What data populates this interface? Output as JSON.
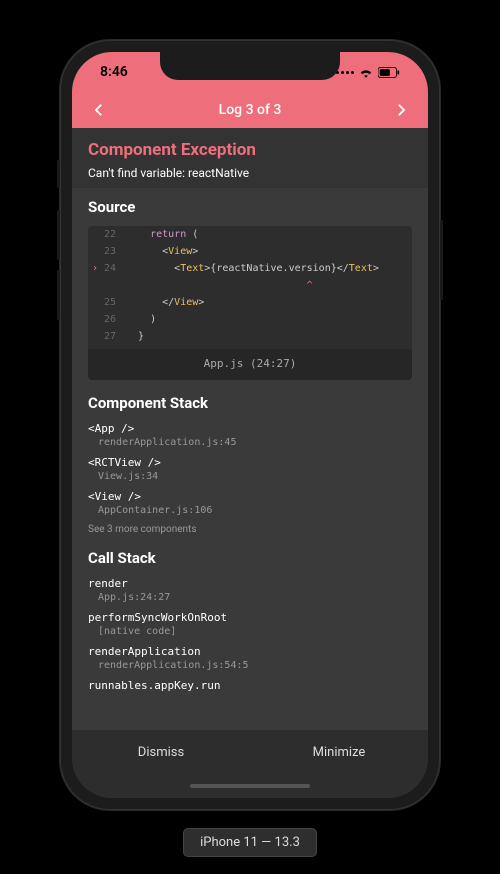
{
  "status": {
    "time": "8:46"
  },
  "nav": {
    "title": "Log 3 of 3"
  },
  "error": {
    "title": "Component Exception",
    "message": "Can't find variable: reactNative"
  },
  "source": {
    "heading": "Source",
    "lines": [
      {
        "num": "22",
        "indent": "    ",
        "tokens": [
          {
            "t": "kw",
            "v": "return"
          },
          {
            "t": "",
            "v": " ("
          }
        ]
      },
      {
        "num": "23",
        "indent": "      ",
        "tokens": [
          {
            "t": "",
            "v": "<"
          },
          {
            "t": "tag",
            "v": "View"
          },
          {
            "t": "",
            "v": ">"
          }
        ]
      },
      {
        "num": "24",
        "hl": true,
        "indent": "        ",
        "tokens": [
          {
            "t": "",
            "v": "<"
          },
          {
            "t": "tag",
            "v": "Text"
          },
          {
            "t": "",
            "v": ">{reactNative.version}</"
          },
          {
            "t": "tag",
            "v": "Text"
          },
          {
            "t": "",
            "v": ">"
          }
        ]
      },
      {
        "caret": true,
        "indent": "                              ",
        "mark": "^"
      },
      {
        "num": "25",
        "indent": "      ",
        "tokens": [
          {
            "t": "",
            "v": "</"
          },
          {
            "t": "tag",
            "v": "View"
          },
          {
            "t": "",
            "v": ">"
          }
        ]
      },
      {
        "num": "26",
        "indent": "    ",
        "tokens": [
          {
            "t": "",
            "v": ")"
          }
        ]
      },
      {
        "num": "27",
        "indent": "  ",
        "tokens": [
          {
            "t": "",
            "v": "}"
          }
        ]
      }
    ],
    "footer": "App.js (24:27)"
  },
  "component_stack": {
    "heading": "Component Stack",
    "items": [
      {
        "top": "<App />",
        "sub": "renderApplication.js:45"
      },
      {
        "top": "<RCTView />",
        "sub": "View.js:34"
      },
      {
        "top": "<View />",
        "sub": "AppContainer.js:106"
      }
    ],
    "see_more": "See 3 more components"
  },
  "call_stack": {
    "heading": "Call Stack",
    "items": [
      {
        "top": "render",
        "sub": "App.js:24:27"
      },
      {
        "top": "performSyncWorkOnRoot",
        "sub": "[native code]"
      },
      {
        "top": "renderApplication",
        "sub": "renderApplication.js:54:5"
      },
      {
        "top": "runnables.appKey.run",
        "sub": ""
      }
    ]
  },
  "buttons": {
    "dismiss": "Dismiss",
    "minimize": "Minimize"
  },
  "device_label": "iPhone 11 — 13.3"
}
